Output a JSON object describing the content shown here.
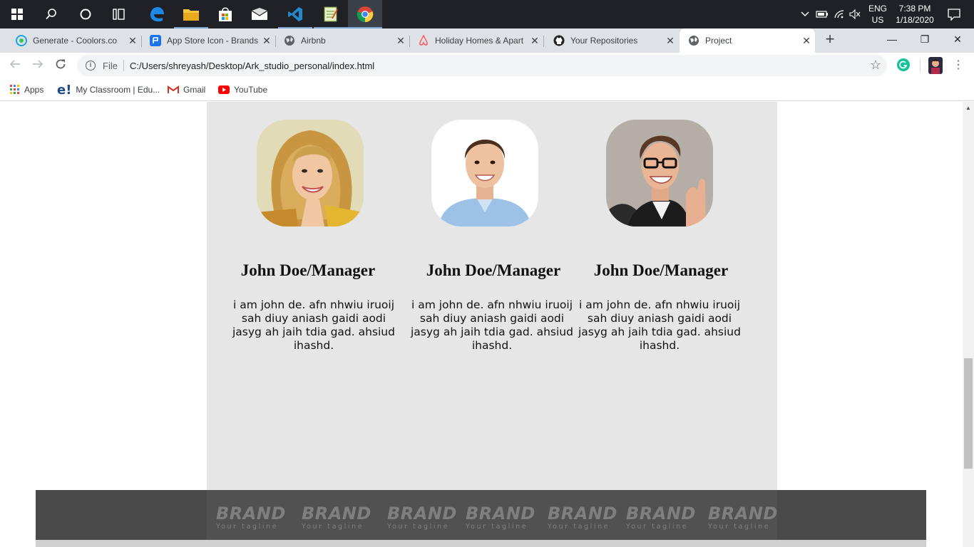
{
  "taskbar": {
    "language_line1": "ENG",
    "language_line2": "US",
    "time": "7:38 PM",
    "date": "1/18/2020",
    "icons": [
      "windows-start-icon",
      "search-icon",
      "cortana-icon",
      "task-view-icon",
      "edge-icon",
      "file-explorer-icon",
      "store-icon",
      "mail-icon",
      "vscode-icon",
      "notepad-icon",
      "chrome-icon"
    ]
  },
  "browser": {
    "tabs": [
      {
        "label": "Generate - Coolors.co",
        "icon": "coolors-icon",
        "color": "#1a73e8"
      },
      {
        "label": "App Store Icon - Brands",
        "icon": "app-store-icon",
        "color": "#1a73e8"
      },
      {
        "label": "Airbnb",
        "icon": "globe-icon",
        "color": "#5f6368"
      },
      {
        "label": "Holiday Homes & Apart",
        "icon": "airbnb-icon",
        "color": "#ff5a5f"
      },
      {
        "label": "Your Repositories",
        "icon": "github-icon",
        "color": "#202124"
      },
      {
        "label": "Project",
        "icon": "globe-icon",
        "color": "#5f6368"
      }
    ],
    "url_scheme_label": "File",
    "url": "C:/Users/shreyash/Desktop/Ark_studio_personal/index.html",
    "bookmarks": [
      {
        "label": "Apps",
        "icon": "apps-grid-icon"
      },
      {
        "label": "My Classroom | Edu...",
        "icon": "edureka-icon"
      },
      {
        "label": "Gmail",
        "icon": "gmail-icon"
      },
      {
        "label": "YouTube",
        "icon": "youtube-icon"
      }
    ]
  },
  "team": [
    {
      "name": "John Doe/Manager",
      "bio": "i am john de. afn nhwiu iruoij sah diuy aniash gaidi aodi jasyg ah jaih tdia gad. ahsiud ihashd.",
      "photo": "woman-blonde-photo"
    },
    {
      "name": "John Doe/Manager",
      "bio": "i am john de. afn nhwiu iruoij sah diuy aniash gaidi aodi jasyg ah jaih tdia gad. ahsiud ihashd.",
      "photo": "man-smiling-photo"
    },
    {
      "name": "John Doe/Manager",
      "bio": "i am john de. afn nhwiu iruoij sah diuy aniash gaidi aodi jasyg ah jaih tdia gad. ahsiud ihashd.",
      "photo": "man-glasses-photo"
    }
  ],
  "brands": [
    {
      "name": "BRAND",
      "tagline": "Your tagline"
    },
    {
      "name": "BRAND",
      "tagline": "Your tagline"
    },
    {
      "name": "BRAND",
      "tagline": "Your tagline"
    },
    {
      "name": "BRAND",
      "tagline": "Your tagline"
    },
    {
      "name": "BRAND",
      "tagline": "Your tagline"
    },
    {
      "name": "BRAND",
      "tagline": "Your tagline"
    },
    {
      "name": "BRAND",
      "tagline": "Your tagline"
    }
  ],
  "colors": {
    "content_background": "#e6e6e6",
    "brand_bar": "#4a4a4a",
    "brand_text": "#7f7f7f"
  }
}
